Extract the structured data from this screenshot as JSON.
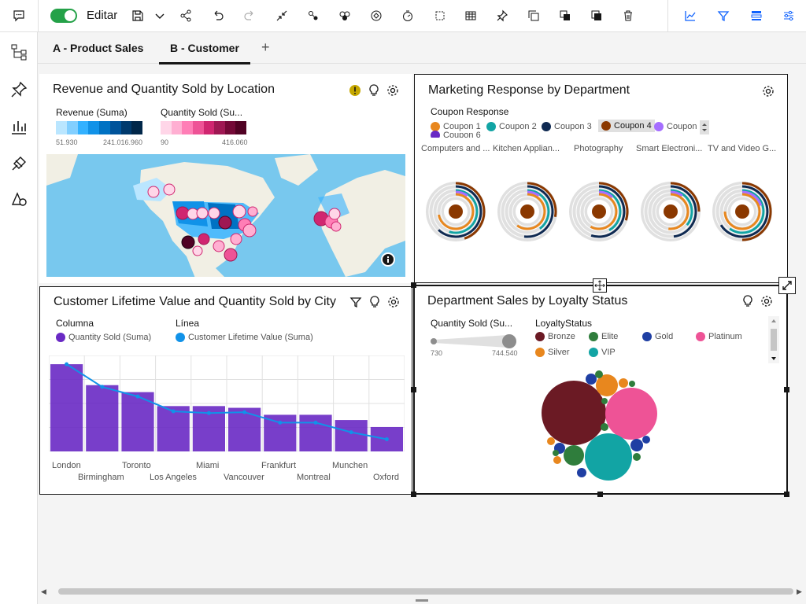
{
  "toolbar": {
    "edit_label": "Editar",
    "accent": "#24a148"
  },
  "tabs": [
    {
      "label": "A - Product Sales"
    },
    {
      "label": "B - Customer"
    }
  ],
  "widgets": {
    "revenue_map": {
      "title": "Revenue and Quantity Sold by Location",
      "legend_revenue": "Revenue (Suma)",
      "revenue_min": "51.930",
      "revenue_max": "241.016.960",
      "legend_quantity": "Quantity Sold (Su...",
      "quantity_min": "90",
      "quantity_max": "416.060"
    },
    "marketing": {
      "title": "Marketing Response by Department",
      "legend_title": "Coupon Response",
      "coupons": [
        {
          "label": "Coupon 1",
          "color": "#e8871e"
        },
        {
          "label": "Coupon 2",
          "color": "#12a4a4"
        },
        {
          "label": "Coupon 3",
          "color": "#0f2a52"
        },
        {
          "label": "Coupon 4",
          "color": "#8a3800"
        },
        {
          "label": "Coupon",
          "color": "#a56eff"
        }
      ],
      "coupon_partial": "Coupon 6",
      "departments": [
        "Computers and ...",
        "Kitchen Applian...",
        "Photography",
        "Smart Electroni...",
        "TV and Video G..."
      ]
    },
    "clv": {
      "title": "Customer Lifetime Value and Quantity Sold by City",
      "legend_col_title": "Columna",
      "legend_col_item": "Quantity Sold (Suma)",
      "legend_line_title": "Línea",
      "legend_line_item": "Customer Lifetime Value (Suma)",
      "bar_color": "#6929c4",
      "line_color": "#1192e8",
      "cities_top": [
        "London",
        "Toronto",
        "Miami",
        "Frankfurt",
        "Munchen"
      ],
      "cities_bottom": [
        "Birmingham",
        "Los Angeles",
        "Vancouver",
        "Montreal",
        "Oxford"
      ]
    },
    "dept_sales": {
      "title": "Department Sales by Loyalty Status",
      "size_legend": "Quantity Sold (Su...",
      "size_min": "730",
      "size_max": "744.540",
      "status_title": "LoyaltyStatus",
      "statuses": [
        {
          "label": "Bronze",
          "color": "#6b1a24"
        },
        {
          "label": "Elite",
          "color": "#2f7d3c"
        },
        {
          "label": "Gold",
          "color": "#1f3fa3"
        },
        {
          "label": "Platinum",
          "color": "#ee5396"
        },
        {
          "label": "Silver",
          "color": "#e8871e"
        },
        {
          "label": "VIP",
          "color": "#12a4a4"
        }
      ]
    }
  },
  "chart_data": [
    {
      "type": "bar",
      "title": "Customer Lifetime Value and Quantity Sold by City",
      "categories": [
        "London",
        "Birmingham",
        "Toronto",
        "Los Angeles",
        "Miami",
        "Vancouver",
        "Frankfurt",
        "Montreal",
        "Munchen",
        "Oxford"
      ],
      "series": [
        {
          "name": "Quantity Sold (Suma)",
          "type": "bar",
          "values": [
            100,
            76,
            68,
            52,
            52,
            50,
            42,
            42,
            36,
            28
          ]
        },
        {
          "name": "Customer Lifetime Value (Suma)",
          "type": "line",
          "values": [
            100,
            74,
            63,
            46,
            44,
            45,
            33,
            33,
            22,
            14
          ]
        }
      ],
      "ylim": [
        0,
        110
      ],
      "grid": true
    }
  ]
}
